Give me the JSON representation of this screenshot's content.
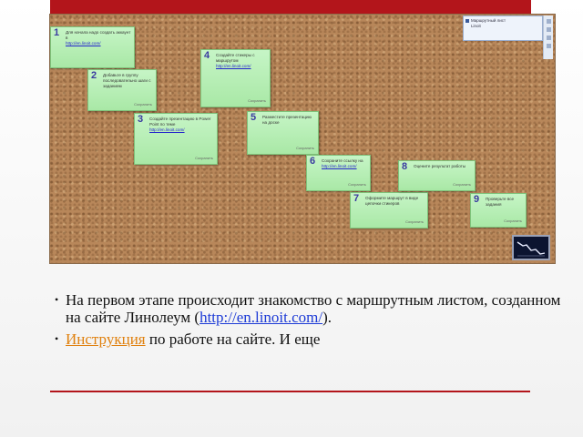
{
  "board": {
    "window_title": "Маршрутный лист",
    "window_sub": "Linoit",
    "notes": [
      {
        "num": "1",
        "text": "Для начала надо создать аккаунт в",
        "link": "http://en.linoit.com/",
        "footer": ""
      },
      {
        "num": "2",
        "text": "Добавьте в группу последовательно шаги с заданием",
        "link": "",
        "footer": "Сохранить"
      },
      {
        "num": "3",
        "text": "Создайте презентацию в Power Point по теме",
        "link": "http://en.linoit.com/",
        "footer": "Сохранить"
      },
      {
        "num": "4",
        "text": "Создайте стикеры с маршрутом",
        "link": "http://en.linoit.com/",
        "footer": "Сохранить"
      },
      {
        "num": "5",
        "text": "Разместите презентацию на доске",
        "link": "",
        "footer": "Сохранить"
      },
      {
        "num": "6",
        "text": "Сохраните ссылку на",
        "link": "http://en.linoit.com/",
        "footer": "Сохранить"
      },
      {
        "num": "7",
        "text": "Оформите маршрут в виде цепочки стикеров",
        "link": "",
        "footer": "Сохранить"
      },
      {
        "num": "8",
        "text": "Оцените результат работы",
        "link": "",
        "footer": "Сохранить"
      },
      {
        "num": "9",
        "text": "Проверьте все задания",
        "link": "",
        "footer": "Сохранить"
      }
    ]
  },
  "bullets": {
    "b1_text": "На первом этапе происходит знакомство с маршрутным листом, созданном на сайте Линолеум (",
    "b1_link": "http://en.linoit.com/",
    "b1_end": ").",
    "b2_link": "Инструкция",
    "b2_text": " по работе на сайте. И еще"
  },
  "colors": {
    "accent_red": "#b3151b",
    "link_blue": "#1d3bd6",
    "link_orange": "#e0810f",
    "note_green": "#b6eeb3",
    "cork": "#b8875a"
  }
}
